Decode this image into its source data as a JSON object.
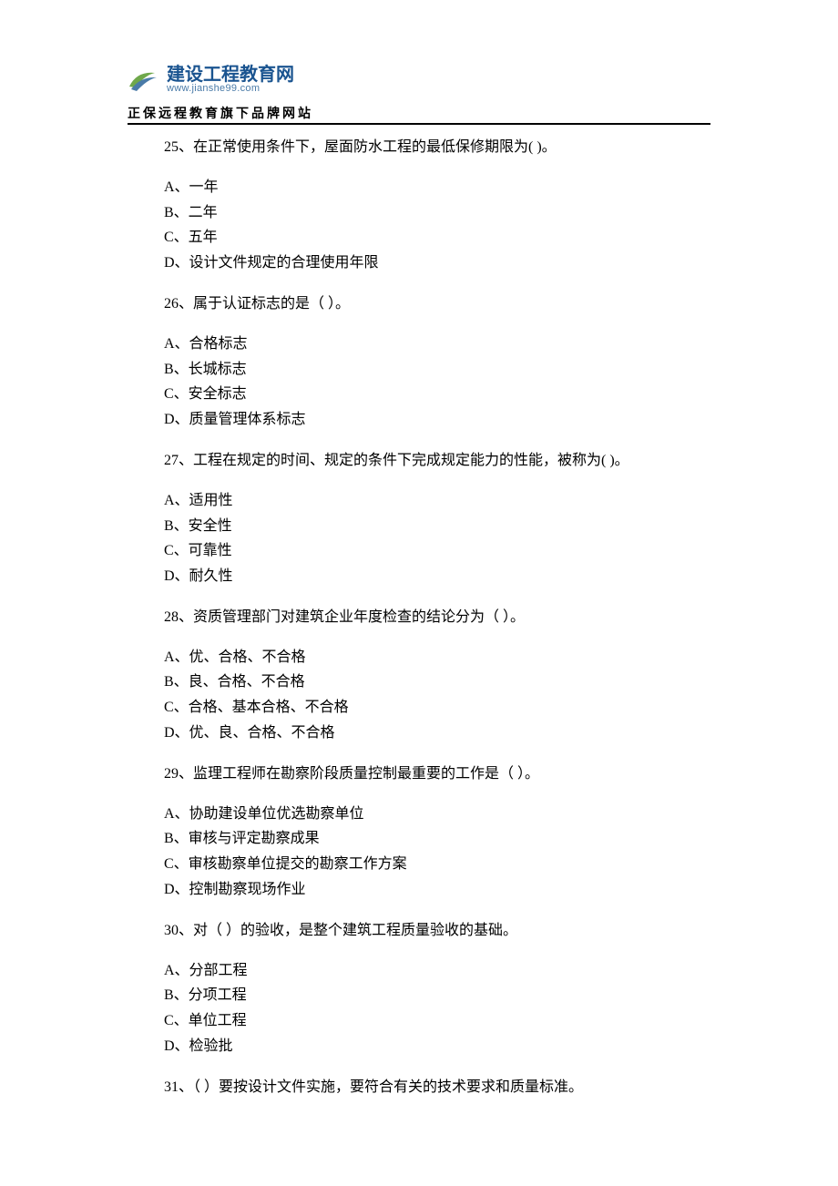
{
  "header": {
    "logo_main": "建设工程教育网",
    "logo_url": "www.jianshe99.com",
    "tagline": "正保远程教育旗下品牌网站"
  },
  "questions": [
    {
      "stem": "25、在正常使用条件下，屋面防水工程的最低保修期限为( )。",
      "options": [
        "A、一年",
        "B、二年",
        "C、五年",
        "D、设计文件规定的合理使用年限"
      ]
    },
    {
      "stem": "26、属于认证标志的是（ ）。",
      "options": [
        "A、合格标志",
        "B、长城标志",
        "C、安全标志",
        "D、质量管理体系标志"
      ]
    },
    {
      "stem": "27、工程在规定的时间、规定的条件下完成规定能力的性能，被称为( )。",
      "options": [
        "A、适用性",
        "B、安全性",
        "C、可靠性",
        "D、耐久性"
      ]
    },
    {
      "stem": "28、资质管理部门对建筑企业年度检查的结论分为（ ）。",
      "options": [
        "A、优、合格、不合格",
        "B、良、合格、不合格",
        "C、合格、基本合格、不合格",
        "D、优、良、合格、不合格"
      ]
    },
    {
      "stem": "29、监理工程师在勘察阶段质量控制最重要的工作是（ ）。",
      "options": [
        "A、协助建设单位优选勘察单位",
        "B、审核与评定勘察成果",
        "C、审核勘察单位提交的勘察工作方案",
        "D、控制勘察现场作业"
      ]
    },
    {
      "stem": "30、对（ ）的验收，是整个建筑工程质量验收的基础。",
      "options": [
        "A、分部工程",
        "B、分项工程",
        "C、单位工程",
        "D、检验批"
      ]
    },
    {
      "stem": "31、（ ）要按设计文件实施，要符合有关的技术要求和质量标准。",
      "options": []
    }
  ]
}
